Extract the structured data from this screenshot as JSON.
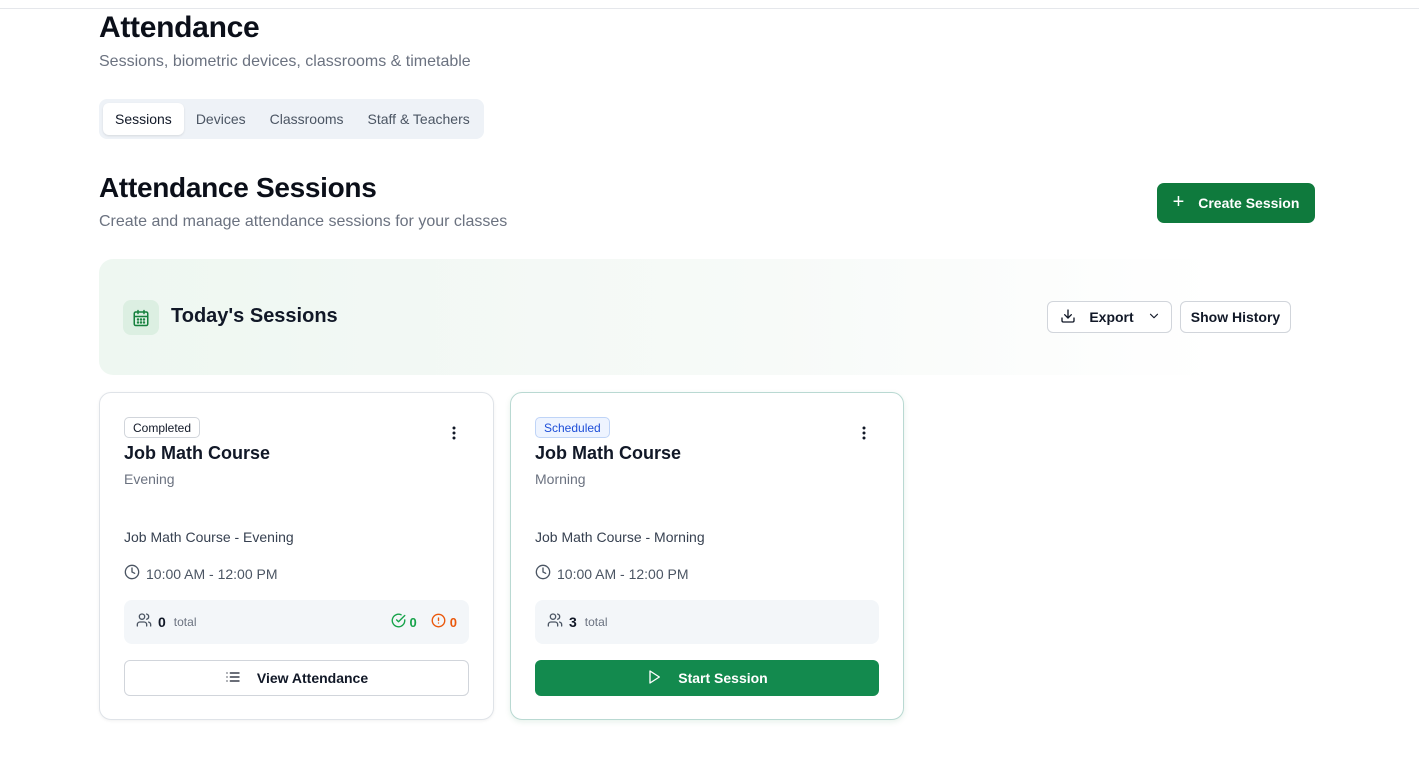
{
  "header": {
    "title": "Attendance",
    "subtitle": "Sessions, biometric devices, classrooms & timetable"
  },
  "tabs": [
    {
      "label": "Sessions",
      "active": true
    },
    {
      "label": "Devices",
      "active": false
    },
    {
      "label": "Classrooms",
      "active": false
    },
    {
      "label": "Staff & Teachers",
      "active": false
    }
  ],
  "section": {
    "title": "Attendance Sessions",
    "subtitle": "Create and manage attendance sessions for your classes",
    "create_label": "Create Session",
    "create_icon": "plus-icon"
  },
  "today": {
    "title": "Today's Sessions",
    "icon": "calendar-icon",
    "export_label": "Export",
    "history_label": "Show History"
  },
  "sessions": [
    {
      "status": "Completed",
      "name": "Job Math Course",
      "shift": "Evening",
      "full_name": "Job Math Course - Evening",
      "time": "10:00 AM - 12:00 PM",
      "total": "0",
      "total_label": "total",
      "present": "0",
      "late": "0",
      "action_label": "View Attendance",
      "action_icon": "list-icon"
    },
    {
      "status": "Scheduled",
      "name": "Job Math Course",
      "shift": "Morning",
      "full_name": "Job Math Course - Morning",
      "time": "10:00 AM - 12:00 PM",
      "total": "3",
      "total_label": "total",
      "action_label": "Start Session",
      "action_icon": "play-icon"
    }
  ],
  "colors": {
    "primary": "#0f7a3d",
    "present": "#16a34a",
    "late": "#ea580c",
    "scheduled": "#1d4ed8"
  }
}
